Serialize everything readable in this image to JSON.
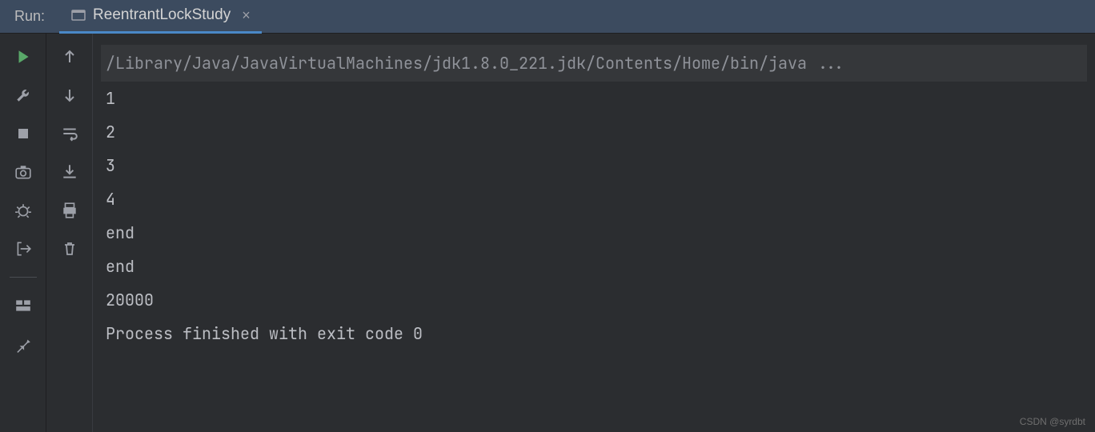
{
  "header": {
    "run_label": "Run:",
    "tab_title": "ReentrantLockStudy"
  },
  "console": {
    "command": "/Library/Java/JavaVirtualMachines/jdk1.8.0_221.jdk/Contents/Home/bin/java ...",
    "lines": [
      "1",
      "2",
      "3",
      "4",
      "end",
      "end",
      "20000",
      "",
      "Process finished with exit code 0"
    ]
  },
  "watermark": "CSDN @syrdbt"
}
